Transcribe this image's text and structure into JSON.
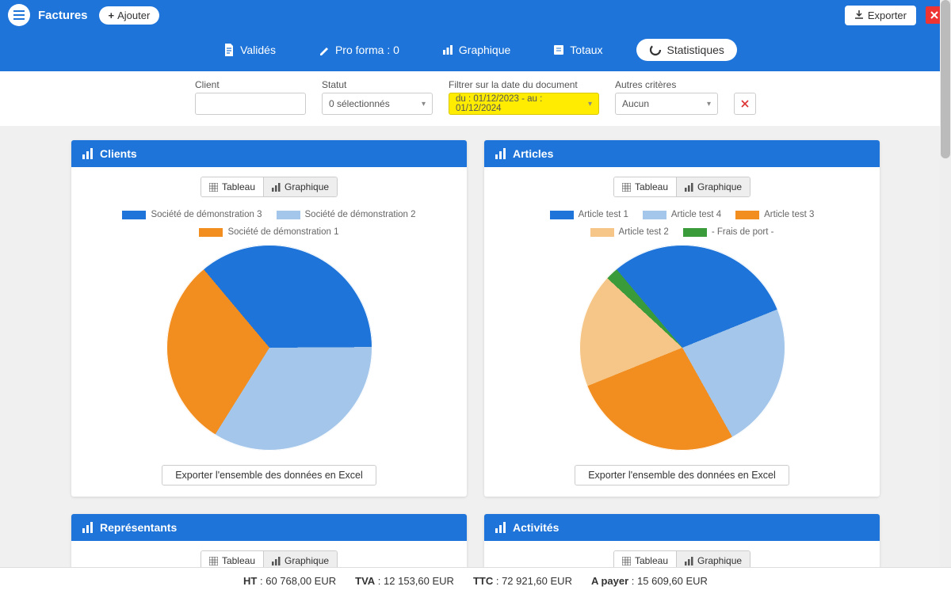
{
  "header": {
    "title": "Factures",
    "add_label": "Ajouter",
    "export_label": "Exporter"
  },
  "tabs": {
    "valides": "Validés",
    "proforma": "Pro forma : 0",
    "graphique": "Graphique",
    "totaux": "Totaux",
    "statistiques": "Statistiques"
  },
  "filters": {
    "client_label": "Client",
    "statut_label": "Statut",
    "statut_value": "0 sélectionnés",
    "date_label": "Filtrer sur la date du document",
    "date_value": "du : 01/12/2023 - au : 01/12/2024",
    "autres_label": "Autres critères",
    "autres_value": "Aucun"
  },
  "cards": {
    "clients": {
      "title": "Clients",
      "toggle_table": "Tableau",
      "toggle_chart": "Graphique",
      "export": "Exporter l'ensemble des données en Excel"
    },
    "articles": {
      "title": "Articles",
      "toggle_table": "Tableau",
      "toggle_chart": "Graphique",
      "export": "Exporter l'ensemble des données en Excel"
    },
    "reps": {
      "title": "Représentants",
      "toggle_table": "Tableau",
      "toggle_chart": "Graphique"
    },
    "acts": {
      "title": "Activités",
      "toggle_table": "Tableau",
      "toggle_chart": "Graphique"
    }
  },
  "chart_data": [
    {
      "type": "pie",
      "title": "Clients",
      "series": [
        {
          "name": "Société de démonstration 3",
          "value": 36,
          "color": "#1e74d8"
        },
        {
          "name": "Société de démonstration 2",
          "value": 34,
          "color": "#a4c6ea"
        },
        {
          "name": "Société de démonstration 1",
          "value": 30,
          "color": "#f28d20"
        }
      ]
    },
    {
      "type": "pie",
      "title": "Articles",
      "series": [
        {
          "name": "Article test 1",
          "value": 30,
          "color": "#1e74d8"
        },
        {
          "name": "Article test 4",
          "value": 23,
          "color": "#a4c6ea"
        },
        {
          "name": "Article test 3",
          "value": 27,
          "color": "#f28d20"
        },
        {
          "name": "Article test 2",
          "value": 18,
          "color": "#f5c687"
        },
        {
          "name": "- Frais de port -",
          "value": 2,
          "color": "#3a9b3a"
        }
      ]
    }
  ],
  "footer": {
    "ht_label": "HT",
    "ht_value": "60 768,00 EUR",
    "tva_label": "TVA",
    "tva_value": "12 153,60 EUR",
    "ttc_label": "TTC",
    "ttc_value": "72 921,60 EUR",
    "apayer_label": "A payer",
    "apayer_value": "15 609,60 EUR"
  }
}
